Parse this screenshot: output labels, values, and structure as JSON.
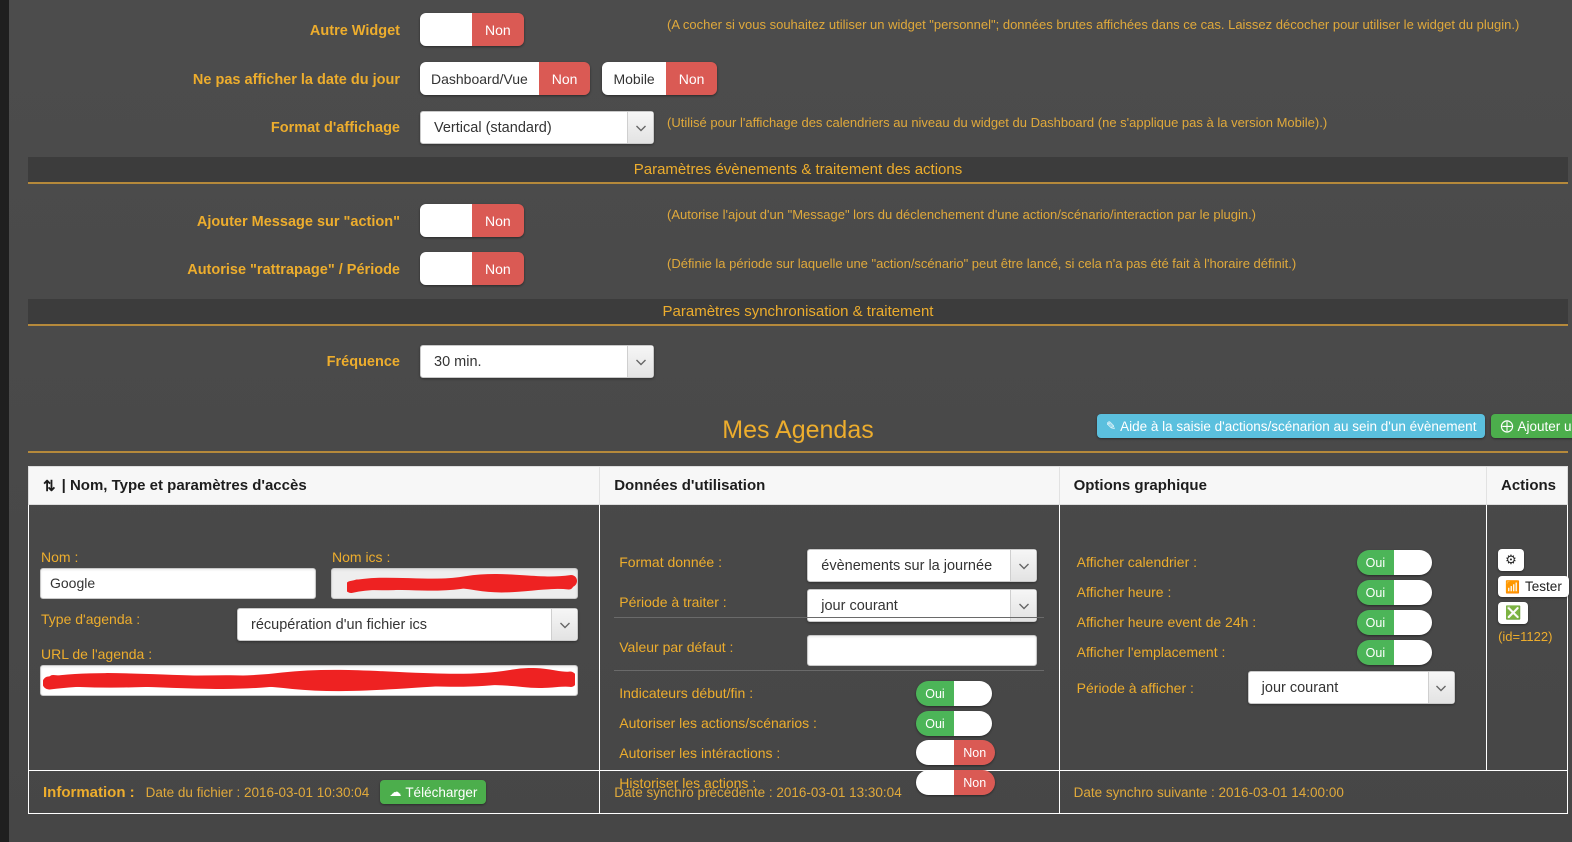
{
  "settings": {
    "rows": [
      {
        "label": "Autre Widget",
        "toggle": {
          "state": "Non",
          "on": false
        },
        "help": "(A cocher si vous souhaitez utiliser un widget \"personnel\"; données brutes affichées dans ce cas. Laissez décocher pour utiliser le widget du plugin.)"
      },
      {
        "label": "Ne pas afficher la date du jour",
        "toggles": [
          {
            "seg": "Dashboard/Vue",
            "state": "Non",
            "on": false
          },
          {
            "seg": "Mobile",
            "state": "Non",
            "on": false
          }
        ],
        "help": ""
      },
      {
        "label": "Format d'affichage",
        "select": "Vertical (standard)",
        "help": "(Utilisé pour l'affichage des calendriers au niveau du widget du Dashboard (ne s'applique pas à la version Mobile).)"
      }
    ]
  },
  "section_events": {
    "title": "Paramètres évènements & traitement des actions",
    "rows": [
      {
        "label": "Ajouter Message sur \"action\"",
        "toggle": {
          "state": "Non",
          "on": false
        },
        "help": "(Autorise l'ajout d'un \"Message\" lors du déclenchement d'une action/scénario/interaction par le plugin.)"
      },
      {
        "label": "Autorise \"rattrapage\" / Période",
        "toggle": {
          "state": "Non",
          "on": false
        },
        "help": "(Définie la période sur laquelle une \"action/scénario\" peut être lancé, si cela n'a pas été fait à l'horaire définit.)"
      }
    ]
  },
  "section_sync": {
    "title": "Paramètres synchronisation & traitement",
    "rows": [
      {
        "label": "Fréquence",
        "select": "30 min.",
        "help": ""
      }
    ]
  },
  "agendas": {
    "title": "Mes Agendas",
    "help_button": "Aide à la saisie d'actions/scénarion au sein d'un évènement",
    "add_button": "Ajouter un agenda",
    "help_icon": "pencil-icon",
    "add_icon": "plus-circle-icon",
    "columns": [
      {
        "label": "| Nom, Type et paramètres d'accès",
        "icon": "sort-icon"
      },
      {
        "label": "Données d'utilisation",
        "icon": ""
      },
      {
        "label": "Options graphique",
        "icon": ""
      },
      {
        "label": "Actions",
        "icon": ""
      }
    ],
    "col_access": {
      "nom_label": "Nom :",
      "nom_value": "Google",
      "nom_ics_label": "Nom ics :",
      "nom_ics_value": "",
      "type_label": "Type d'agenda :",
      "type_value": "récupération d'un fichier ics",
      "url_label": "URL de l'agenda :",
      "url_value": ""
    },
    "col_data": {
      "format_label": "Format donnée :",
      "format_value": "évènements sur la journée",
      "periode_label": "Période à traiter :",
      "periode_value": "jour courant",
      "defaut_label": "Valeur par défaut :",
      "defaut_value": "",
      "toggles": [
        {
          "label": "Indicateurs début/fin :",
          "state": "Oui",
          "on": true
        },
        {
          "label": "Autoriser les actions/scénarios :",
          "state": "Oui",
          "on": true
        },
        {
          "label": "Autoriser les intéractions :",
          "state": "Non",
          "on": false
        },
        {
          "label": "Historiser les actions :",
          "state": "Non",
          "on": false
        }
      ]
    },
    "col_graph": {
      "toggles": [
        {
          "label": "Afficher calendrier :",
          "state": "Oui",
          "on": true
        },
        {
          "label": "Afficher heure :",
          "state": "Oui",
          "on": true
        },
        {
          "label": "Afficher heure event de 24h :",
          "state": "Oui",
          "on": true
        },
        {
          "label": "Afficher l'emplacement :",
          "state": "Oui",
          "on": true
        }
      ],
      "periode_label": "Période à afficher :",
      "periode_value": "jour courant"
    },
    "col_actions": {
      "config_icon": "gears-icon",
      "test_label": "Tester",
      "test_icon": "rss-icon",
      "remove_icon": "minus-circle-icon",
      "id_text": "(id=1122)"
    },
    "footer": {
      "information_label": "Information :",
      "file_date": "Date du fichier : 2016-03-01 10:30:04",
      "download_button": "Télécharger",
      "download_icon": "cloud-download-icon",
      "prev_sync": "Date synchro précédente : 2016-03-01 13:30:04",
      "next_sync": "Date synchro suivante : 2016-03-01 14:00:00"
    }
  },
  "colors": {
    "accent": "#edad2d",
    "danger": "#da5a54",
    "success": "#4cb558",
    "info": "#5bc0de",
    "redaction": "#ee2222"
  }
}
